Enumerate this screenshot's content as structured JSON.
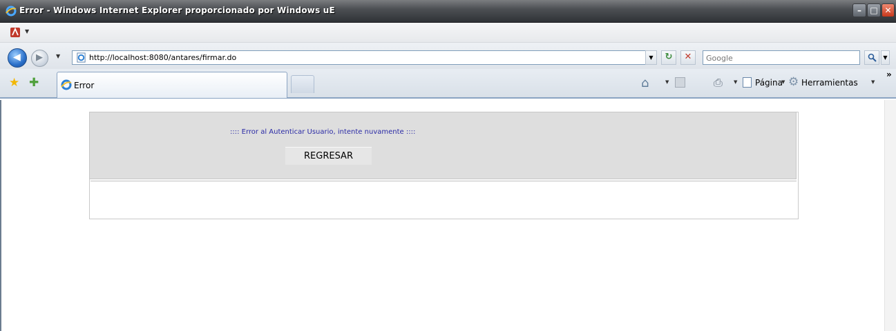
{
  "window": {
    "title": "Error - Windows Internet Explorer proporcionado por Windows uE",
    "min_label": "–",
    "max_label": "□",
    "close_label": "✕"
  },
  "nav": {
    "back_glyph": "◀",
    "forward_glyph": "▶",
    "dropdown_glyph": "▼"
  },
  "address": {
    "url": "http://localhost:8080/antares/firmar.do"
  },
  "search": {
    "placeholder": "Google"
  },
  "tab": {
    "label": "Error"
  },
  "command_bar": {
    "page_label": "Página",
    "tools_label": "Herramientas",
    "more_glyph": "»"
  },
  "content": {
    "error_message": ":::: Error al Autenticar Usuario, intente nuvamente ::::",
    "back_button_label": "REGRESAR"
  },
  "colors": {
    "error_text": "#2a2aa5",
    "panel_bg": "#dedede"
  }
}
